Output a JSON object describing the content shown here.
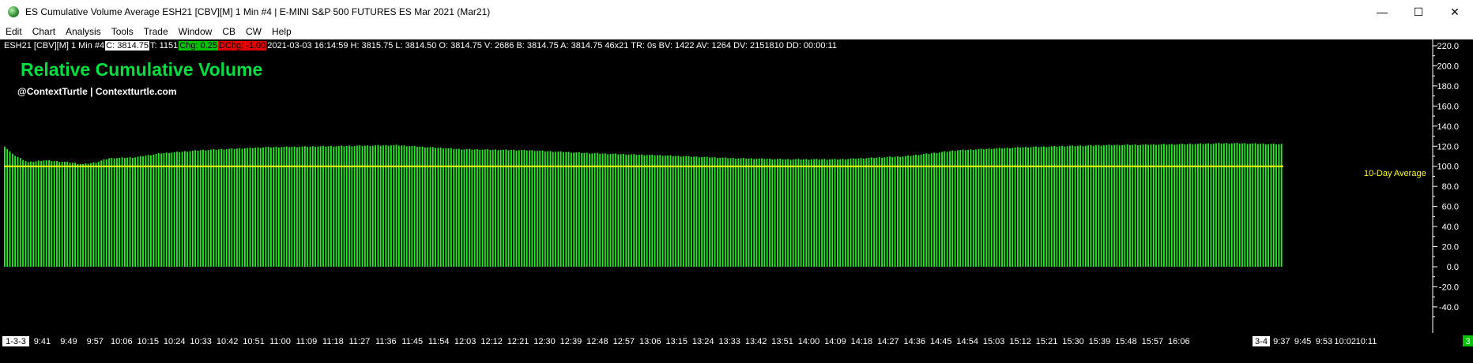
{
  "window": {
    "title": "ES Cumulative Volume Average ESH21 [CBV][M]  1 Min  #4 | E-MINI S&P 500 FUTURES ES Mar 2021 (Mar21)",
    "minimize_glyph": "—",
    "maximize_glyph": "☐",
    "close_glyph": "✕"
  },
  "menu": [
    "Edit",
    "Chart",
    "Analysis",
    "Tools",
    "Trade",
    "Window",
    "CB",
    "CW",
    "Help"
  ],
  "infobar": {
    "symbol": "ESH21 [CBV][M]  1 Min  #4",
    "close": "C: 3814.75",
    "trades": "T: 1151",
    "chg": "Chg: 0.25",
    "dchg": "DChg: -1.00",
    "rest": "2021-03-03 16:14:59 H: 3815.75 L: 3814.50 O: 3814.75 V: 2686 B: 3814.75 A: 3814.75 46x21 TR: 0s BV: 1422 AV: 1264 DV: 2151810 DD: 00:00:11"
  },
  "chart_title": "Relative Cumulative Volume",
  "chart_subtitle": "@ContextTurtle | Contextturtle.com",
  "reference_label": "10-Day Average",
  "colors": {
    "bars": "#22ee22",
    "reference_line": "#ffff00",
    "axis_text": "#ffffff",
    "background": "#000000"
  },
  "chart_data": {
    "type": "bar",
    "ylim": [
      -50,
      230
    ],
    "yticks": [
      220,
      200,
      180,
      160,
      140,
      120,
      100,
      80,
      60,
      40,
      20,
      0,
      -20,
      -40
    ],
    "ytick_labels": [
      "220.0",
      "200.0",
      "180.0",
      "160.0",
      "140.0",
      "120.0",
      "100.0",
      "80.0",
      "60.0",
      "40.0",
      "20.0",
      "0.0",
      "-20.0",
      "-40.0"
    ],
    "reference_value": 100,
    "x_tick_labels": [
      "1-3-3",
      "9:41",
      "9:49",
      "9:57",
      "10:06",
      "10:15",
      "10:24",
      "10:33",
      "10:42",
      "10:51",
      "11:00",
      "11:09",
      "11:18",
      "11:27",
      "11:36",
      "11:45",
      "11:54",
      "12:03",
      "12:12",
      "12:21",
      "12:30",
      "12:39",
      "12:48",
      "12:57",
      "13:06",
      "13:15",
      "13:24",
      "13:33",
      "13:42",
      "13:51",
      "14:00",
      "14:09",
      "14:18",
      "14:27",
      "14:36",
      "14:45",
      "14:54",
      "15:03",
      "15:12",
      "15:21",
      "15:30",
      "15:39",
      "15:48",
      "15:57",
      "16:06",
      "3-4",
      "9:37",
      "9:45",
      "9:53",
      "10:02",
      "10:11"
    ],
    "start_label": "1-3-3",
    "end_label": "3-4",
    "right_badge": "3",
    "profile": [
      [
        0,
        120
      ],
      [
        3,
        112
      ],
      [
        6,
        108
      ],
      [
        9,
        104
      ],
      [
        15,
        106
      ],
      [
        25,
        104
      ],
      [
        30,
        102
      ],
      [
        35,
        104
      ],
      [
        40,
        108
      ],
      [
        50,
        109
      ],
      [
        60,
        113
      ],
      [
        75,
        116
      ],
      [
        100,
        119
      ],
      [
        125,
        120
      ],
      [
        150,
        121
      ],
      [
        175,
        117
      ],
      [
        200,
        116
      ],
      [
        225,
        113
      ],
      [
        250,
        111
      ],
      [
        280,
        108
      ],
      [
        300,
        107
      ],
      [
        320,
        107
      ],
      [
        345,
        110
      ],
      [
        365,
        116
      ],
      [
        390,
        119
      ],
      [
        420,
        121
      ],
      [
        450,
        122
      ],
      [
        470,
        123
      ],
      [
        489,
        122
      ]
    ],
    "bar_count": 490
  }
}
